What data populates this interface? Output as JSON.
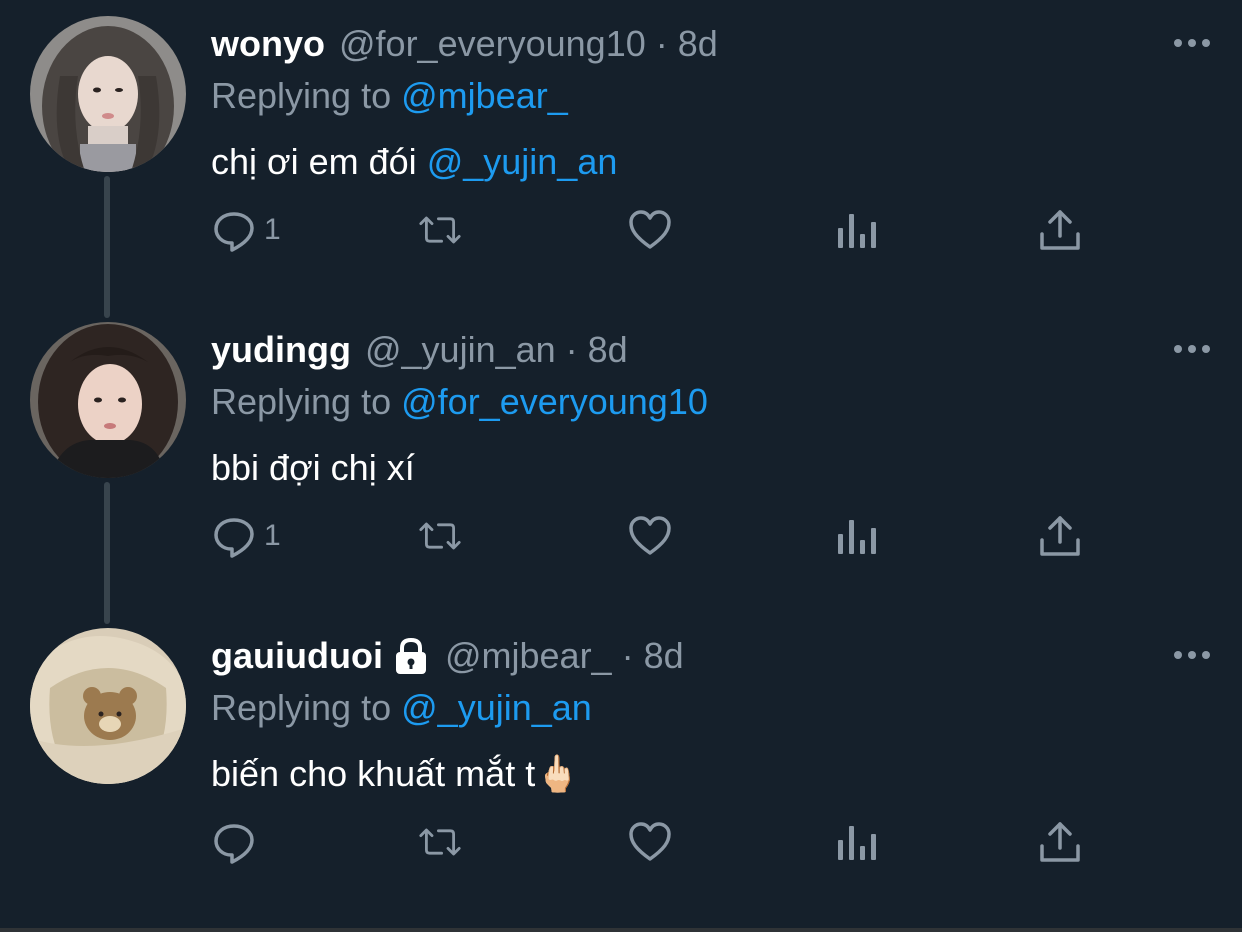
{
  "tweets": [
    {
      "name": "wonyo",
      "handle": "@for_everyoung10",
      "separator": "·",
      "time": "8d",
      "replying_prefix": "Replying to",
      "replying_to": "@mjbear_",
      "text_before": "chị ơi em đói ",
      "text_mention": "@_yujin_an",
      "text_after": "",
      "reply_count": "1",
      "locked": false,
      "avatar": "avatar-girl-long-wavy-hair"
    },
    {
      "name": "yudingg",
      "handle": "@_yujin_an",
      "separator": "·",
      "time": "8d",
      "replying_prefix": "Replying to",
      "replying_to": "@for_everyoung10",
      "text_before": "bbi đợi chị xí",
      "text_mention": "",
      "text_after": "",
      "reply_count": "1",
      "locked": false,
      "avatar": "avatar-girl-selfie"
    },
    {
      "name": "gauiuduoi",
      "handle": "@mjbear_",
      "separator": "·",
      "time": "8d",
      "replying_prefix": "Replying to",
      "replying_to": "@_yujin_an",
      "text_before": "biến cho khuất mắt t",
      "text_mention": "",
      "text_after": "🖕🏻",
      "reply_count": "",
      "locked": true,
      "avatar": "avatar-bear-in-blanket"
    }
  ],
  "icons": {
    "more": "more-horizontal-icon",
    "reply": "reply-bubble-icon",
    "retweet": "retweet-icon",
    "like": "heart-icon",
    "analytics": "analytics-bars-icon",
    "share": "share-upload-icon",
    "lock": "lock-icon"
  },
  "colors": {
    "background": "#15202b",
    "text": "#ffffff",
    "secondary": "#8b98a5",
    "link": "#1d9bf0",
    "thread_line": "#38444d"
  }
}
